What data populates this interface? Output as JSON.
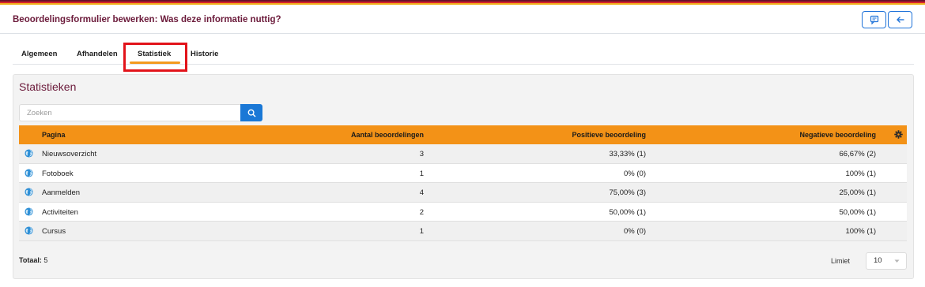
{
  "header": {
    "title": "Beoordelingsformulier bewerken: Was deze informatie nuttig?"
  },
  "tabs": [
    {
      "label": "Algemeen"
    },
    {
      "label": "Afhandelen"
    },
    {
      "label": "Statistiek",
      "active": true
    },
    {
      "label": "Historie"
    }
  ],
  "panel": {
    "title": "Statistieken"
  },
  "search": {
    "placeholder": "Zoeken",
    "value": ""
  },
  "table": {
    "columns": [
      "Pagina",
      "Aantal beoordelingen",
      "Positieve beoordeling",
      "Negatieve beoordeling"
    ],
    "rows": [
      {
        "pagina": "Nieuwsoverzicht",
        "aantal": "3",
        "positief": "33,33% (1)",
        "negatief": "66,67% (2)"
      },
      {
        "pagina": "Fotoboek",
        "aantal": "1",
        "positief": "0% (0)",
        "negatief": "100% (1)"
      },
      {
        "pagina": "Aanmelden",
        "aantal": "4",
        "positief": "75,00% (3)",
        "negatief": "25,00% (1)"
      },
      {
        "pagina": "Activiteiten",
        "aantal": "2",
        "positief": "50,00% (1)",
        "negatief": "50,00% (1)"
      },
      {
        "pagina": "Cursus",
        "aantal": "1",
        "positief": "0% (0)",
        "negatief": "100% (1)"
      }
    ]
  },
  "footer": {
    "total_label": "Totaal:",
    "total_value": "5",
    "limit_label": "Limiet",
    "limit_value": "10"
  },
  "icons": {
    "feedback": "feedback-icon",
    "back": "arrow-left-icon",
    "search": "search-icon",
    "settings": "gear-icon",
    "row": "globe-icon"
  },
  "colors": {
    "title": "#6b1a3a",
    "accent": "#f39217",
    "primary": "#1a78d6",
    "highlight": "#e2131a"
  }
}
